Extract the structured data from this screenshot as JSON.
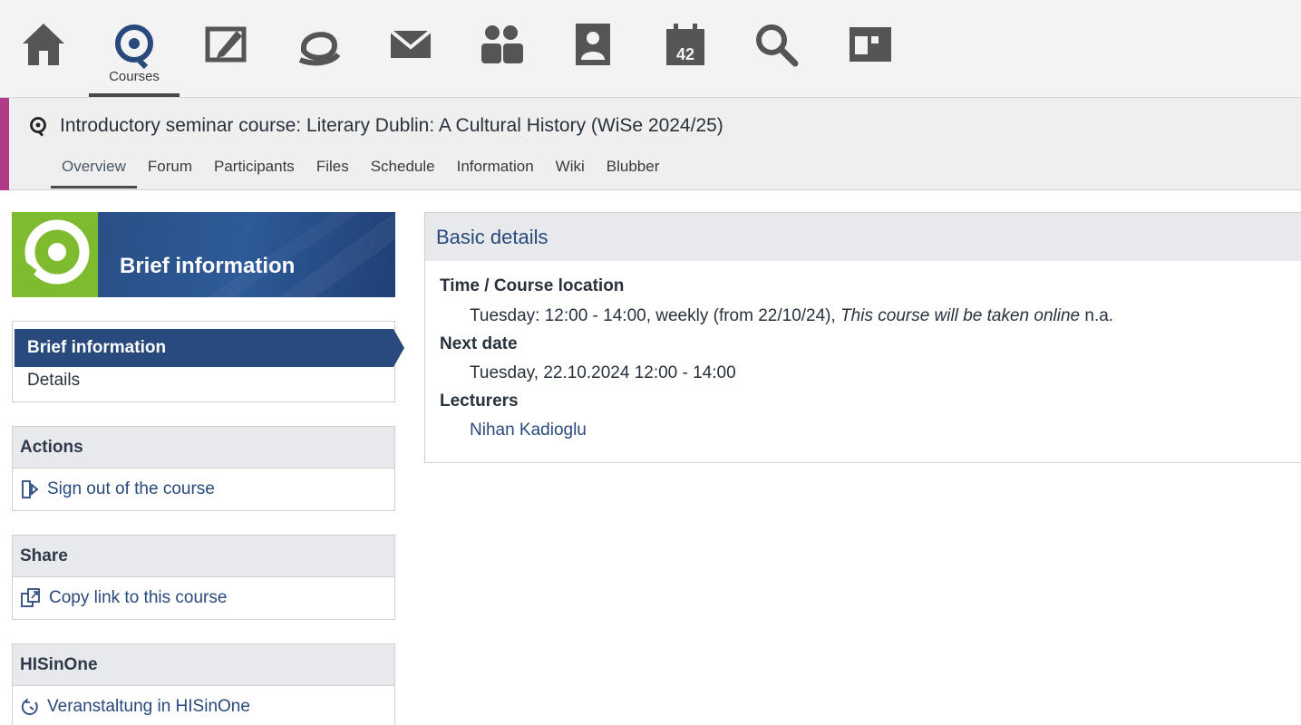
{
  "nav": {
    "items": [
      {
        "name": "home-icon"
      },
      {
        "name": "courses-icon",
        "label": "Courses",
        "active": true
      },
      {
        "name": "workplace-icon"
      },
      {
        "name": "messages-icon"
      },
      {
        "name": "mail-icon"
      },
      {
        "name": "community-icon"
      },
      {
        "name": "profile-icon"
      },
      {
        "name": "calendar-icon",
        "text": "42"
      },
      {
        "name": "search-icon"
      },
      {
        "name": "tools-icon"
      }
    ]
  },
  "course": {
    "title": "Introductory seminar course: Literary Dublin: A Cultural History (WiSe 2024/25)",
    "tabs": [
      "Overview",
      "Forum",
      "Participants",
      "Files",
      "Schedule",
      "Information",
      "Wiki",
      "Blubber"
    ],
    "active_tab": "Overview",
    "accent_color": "#b13c86"
  },
  "sidebar": {
    "banner_title": "Brief information",
    "nav": {
      "active": "Brief information",
      "items": [
        "Brief information",
        "Details"
      ]
    },
    "widgets": [
      {
        "title": "Actions",
        "item": "Sign out of the course",
        "icon": "sign-out-icon"
      },
      {
        "title": "Share",
        "item": "Copy link to this course",
        "icon": "copy-link-icon"
      },
      {
        "title": "HISinOne",
        "item": "Veranstaltung in HISinOne",
        "icon": "external-system-icon"
      }
    ]
  },
  "details": {
    "header": "Basic details",
    "time_label": "Time / Course location",
    "time_value": "Tuesday: 12:00 - 14:00, weekly (from 22/10/24),",
    "time_note": "This course will be taken online",
    "time_suffix": "n.a.",
    "next_label": "Next date",
    "next_value": "Tuesday, 22.10.2024 12:00 - 14:00",
    "lecturers_label": "Lecturers",
    "lecturer": "Nihan Kadioglu"
  },
  "colors": {
    "brand_blue": "#28497c",
    "brand_green": "#7ebb2f",
    "icon_gray": "#555555"
  }
}
